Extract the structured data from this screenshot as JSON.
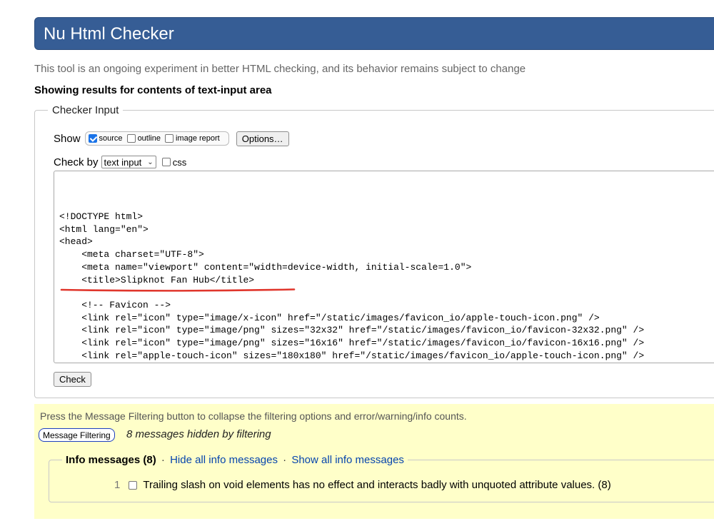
{
  "header": {
    "title": "Nu Html Checker"
  },
  "tagline": "This tool is an ongoing experiment in better HTML checking, and its behavior remains subject to change",
  "showing": "Showing results for contents of text-input area",
  "checker_input": {
    "legend": "Checker Input",
    "show_label": "Show",
    "show_options": [
      {
        "label": "source",
        "checked": true
      },
      {
        "label": "outline",
        "checked": false
      },
      {
        "label": "image report",
        "checked": false
      }
    ],
    "options_button": "Options…",
    "check_by_label": "Check by",
    "check_by_value": "text input",
    "css_label": "css",
    "css_checked": false,
    "code_lines": [
      "<!DOCTYPE html>",
      "<html lang=\"en\">",
      "<head>",
      "    <meta charset=\"UTF-8\">",
      "    <meta name=\"viewport\" content=\"width=device-width, initial-scale=1.0\">",
      "    <title>Slipknot Fan Hub</title>",
      "",
      "    <!-- Favicon -->",
      "    <link rel=\"icon\" type=\"image/x-icon\" href=\"/static/images/favicon_io/apple-touch-icon.png\" />",
      "    <link rel=\"icon\" type=\"image/png\" sizes=\"32x32\" href=\"/static/images/favicon_io/favicon-32x32.png\" />",
      "    <link rel=\"icon\" type=\"image/png\" sizes=\"16x16\" href=\"/static/images/favicon_io/favicon-16x16.png\" />",
      "    <link rel=\"apple-touch-icon\" sizes=\"180x180\" href=\"/static/images/favicon_io/apple-touch-icon.png\" />"
    ],
    "underline_color": "#e0362c",
    "check_button": "Check"
  },
  "filtering": {
    "note": "Press the Message Filtering button to collapse the filtering options and error/warning/info counts.",
    "button": "Message Filtering",
    "hidden_text": "8 messages hidden by filtering",
    "info": {
      "title": "Info messages (8)",
      "separator": "·",
      "hide_all": "Hide all info messages",
      "show_all": "Show all info messages",
      "items": [
        {
          "number": "1",
          "text": "Trailing slash on void elements has no effect and interacts badly with unquoted attribute values. (8)",
          "checked": false
        }
      ]
    }
  },
  "colors": {
    "header_bg": "#365d95",
    "filter_bg": "#ffffc9",
    "link": "#0645ad"
  }
}
